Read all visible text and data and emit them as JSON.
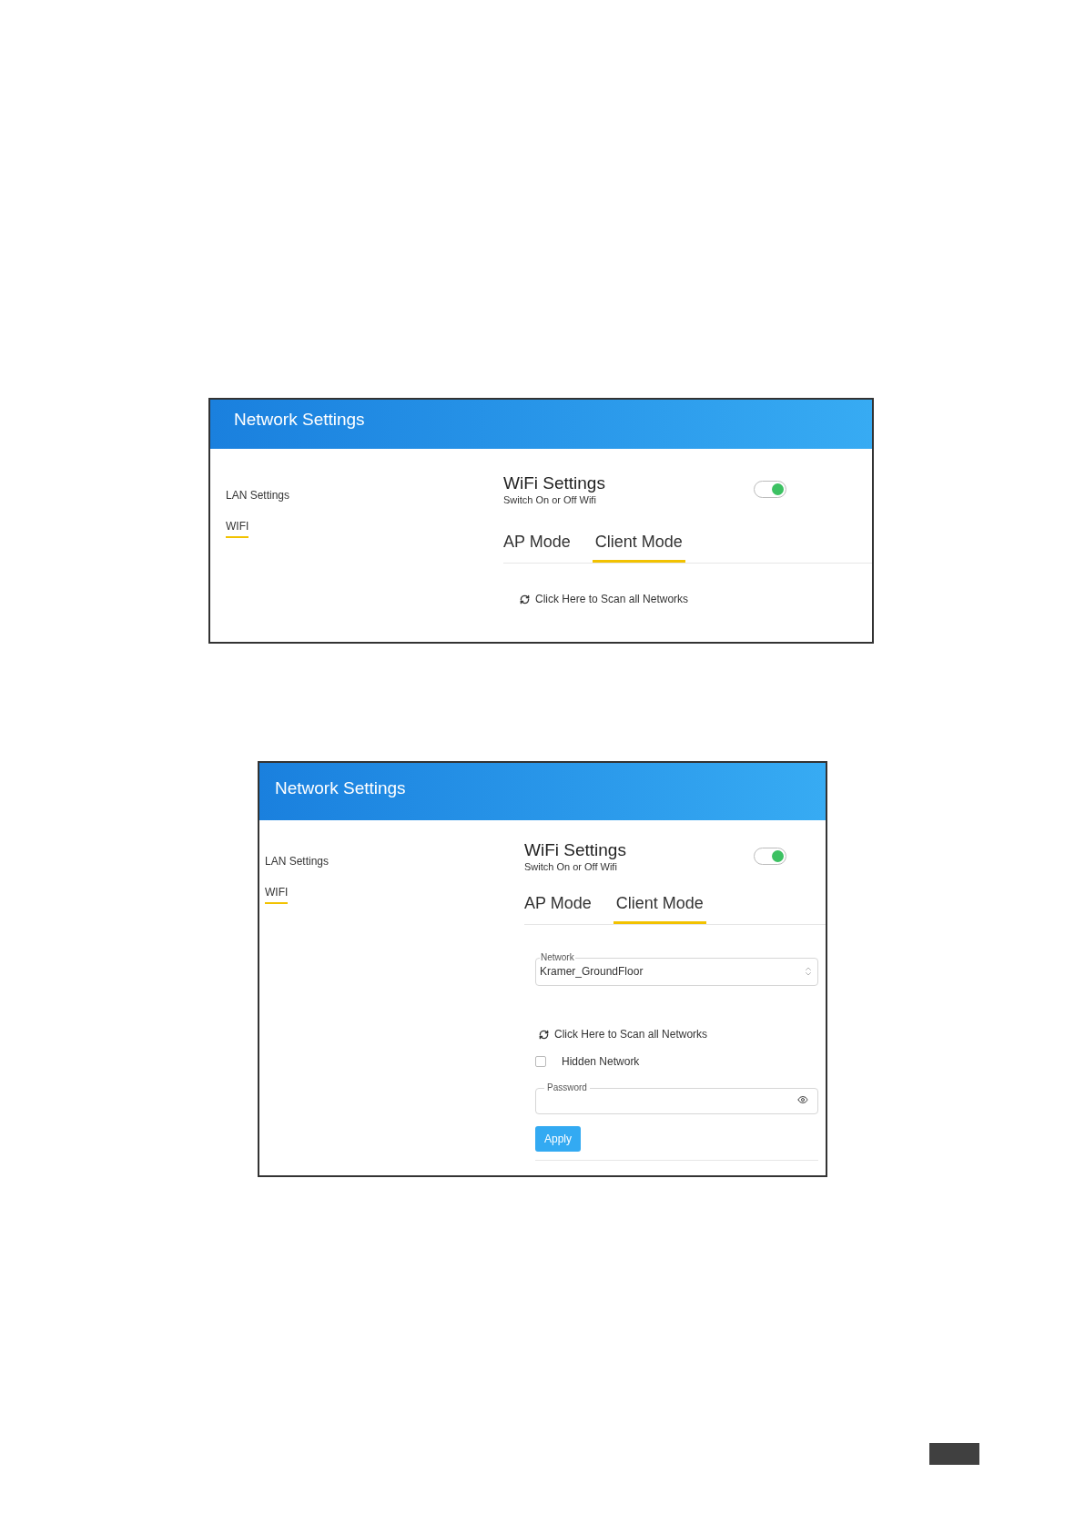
{
  "screens": [
    {
      "header_title": "Network Settings",
      "sidebar": [
        {
          "label": "LAN Settings",
          "selected": false
        },
        {
          "label": "WIFI",
          "selected": true
        }
      ],
      "section_title": "WiFi Settings",
      "section_subtitle": "Switch On or Off Wifi",
      "wifi_on": true,
      "tabs": [
        {
          "label": "AP Mode",
          "selected": false
        },
        {
          "label": "Client Mode",
          "selected": true
        }
      ],
      "form": [
        {
          "kind": "scan_link",
          "label": "Click Here to Scan all Networks"
        }
      ]
    },
    {
      "header_title": "Network Settings",
      "sidebar": [
        {
          "label": "LAN Settings",
          "selected": false
        },
        {
          "label": "WIFI",
          "selected": true
        }
      ],
      "section_title": "WiFi Settings",
      "section_subtitle": "Switch On or Off Wifi",
      "wifi_on": true,
      "tabs": [
        {
          "label": "AP Mode",
          "selected": false
        },
        {
          "label": "Client Mode",
          "selected": true
        }
      ],
      "form": [
        {
          "kind": "select",
          "label": "Network",
          "value": "Kramer_GroundFloor"
        },
        {
          "kind": "scan_link",
          "label": "Click Here to Scan all Networks"
        },
        {
          "kind": "checkbox",
          "label": "Hidden Network",
          "checked": false
        },
        {
          "kind": "password",
          "label": "Password"
        },
        {
          "kind": "button",
          "label": "Apply"
        }
      ]
    }
  ]
}
